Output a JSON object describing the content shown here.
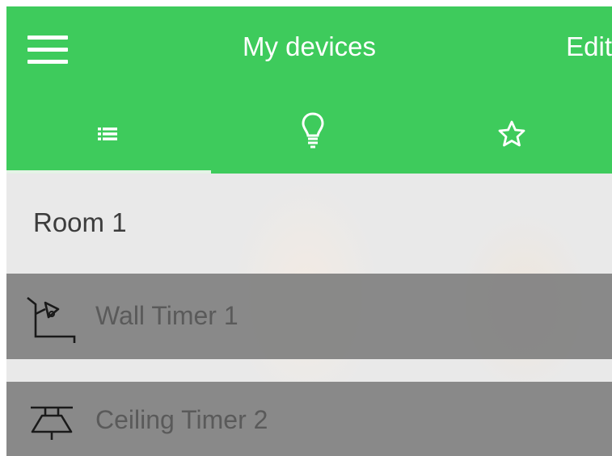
{
  "header": {
    "title": "My devices",
    "edit_label": "Edit"
  },
  "tabs": [
    {
      "name": "list",
      "icon": "list-icon",
      "active": true
    },
    {
      "name": "bulbs",
      "icon": "lightbulb-icon",
      "active": false
    },
    {
      "name": "favorites",
      "icon": "star-icon",
      "active": false
    }
  ],
  "room": {
    "title": "Room 1",
    "devices": [
      {
        "label": "Wall Timer 1",
        "icon": "wall-lamp-icon"
      },
      {
        "label": "Ceiling Timer 2",
        "icon": "ceiling-lamp-icon"
      }
    ]
  },
  "colors": {
    "accent": "#3ecb5c",
    "row_bg": "#808080",
    "text_dark": "#3c3c3c"
  }
}
